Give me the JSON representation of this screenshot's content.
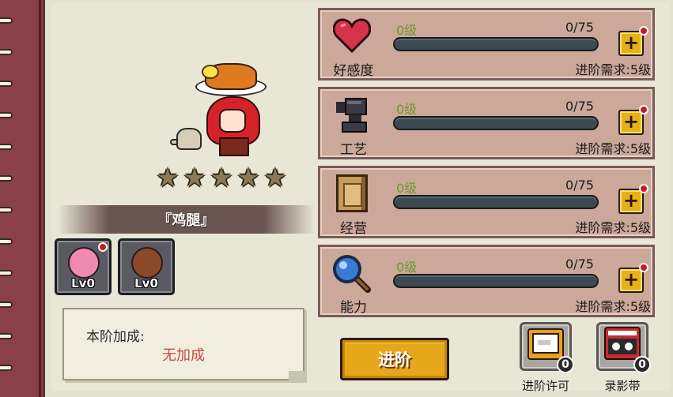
{
  "character": {
    "name": "『鸡腿』",
    "stars_total": 5,
    "stars_filled": 0
  },
  "companions": [
    {
      "level_label": "Lv0",
      "has_notification": true,
      "hair_color": "#f08ab0"
    },
    {
      "level_label": "Lv0",
      "has_notification": false,
      "hair_color": "#8a4a2a"
    }
  ],
  "bonus": {
    "title": "本阶加成:",
    "value": "无加成"
  },
  "stats": [
    {
      "label": "好感度",
      "icon": "heart-icon",
      "level": "0级",
      "progress": "0/75",
      "progress_fraction": 0,
      "requirement": "进阶需求:5级"
    },
    {
      "label": "工艺",
      "icon": "anvil-icon",
      "level": "0级",
      "progress": "0/75",
      "progress_fraction": 0,
      "requirement": "进阶需求:5级"
    },
    {
      "label": "经营",
      "icon": "book-icon",
      "level": "0级",
      "progress": "0/75",
      "progress_fraction": 0,
      "requirement": "进阶需求:5级"
    },
    {
      "label": "能力",
      "icon": "magnifier-icon",
      "level": "0级",
      "progress": "0/75",
      "progress_fraction": 0,
      "requirement": "进阶需求:5级"
    }
  ],
  "actions": {
    "advance_label": "进阶"
  },
  "items": [
    {
      "label": "进阶许可",
      "count": "0",
      "icon": "permit-card-icon"
    },
    {
      "label": "录影带",
      "count": "0",
      "icon": "videotape-icon"
    }
  ],
  "colors": {
    "level_text": "#6a9a2a",
    "bonus_text": "#c84848",
    "advance_button": "#e6a81a",
    "notification_dot": "#c41c24"
  }
}
